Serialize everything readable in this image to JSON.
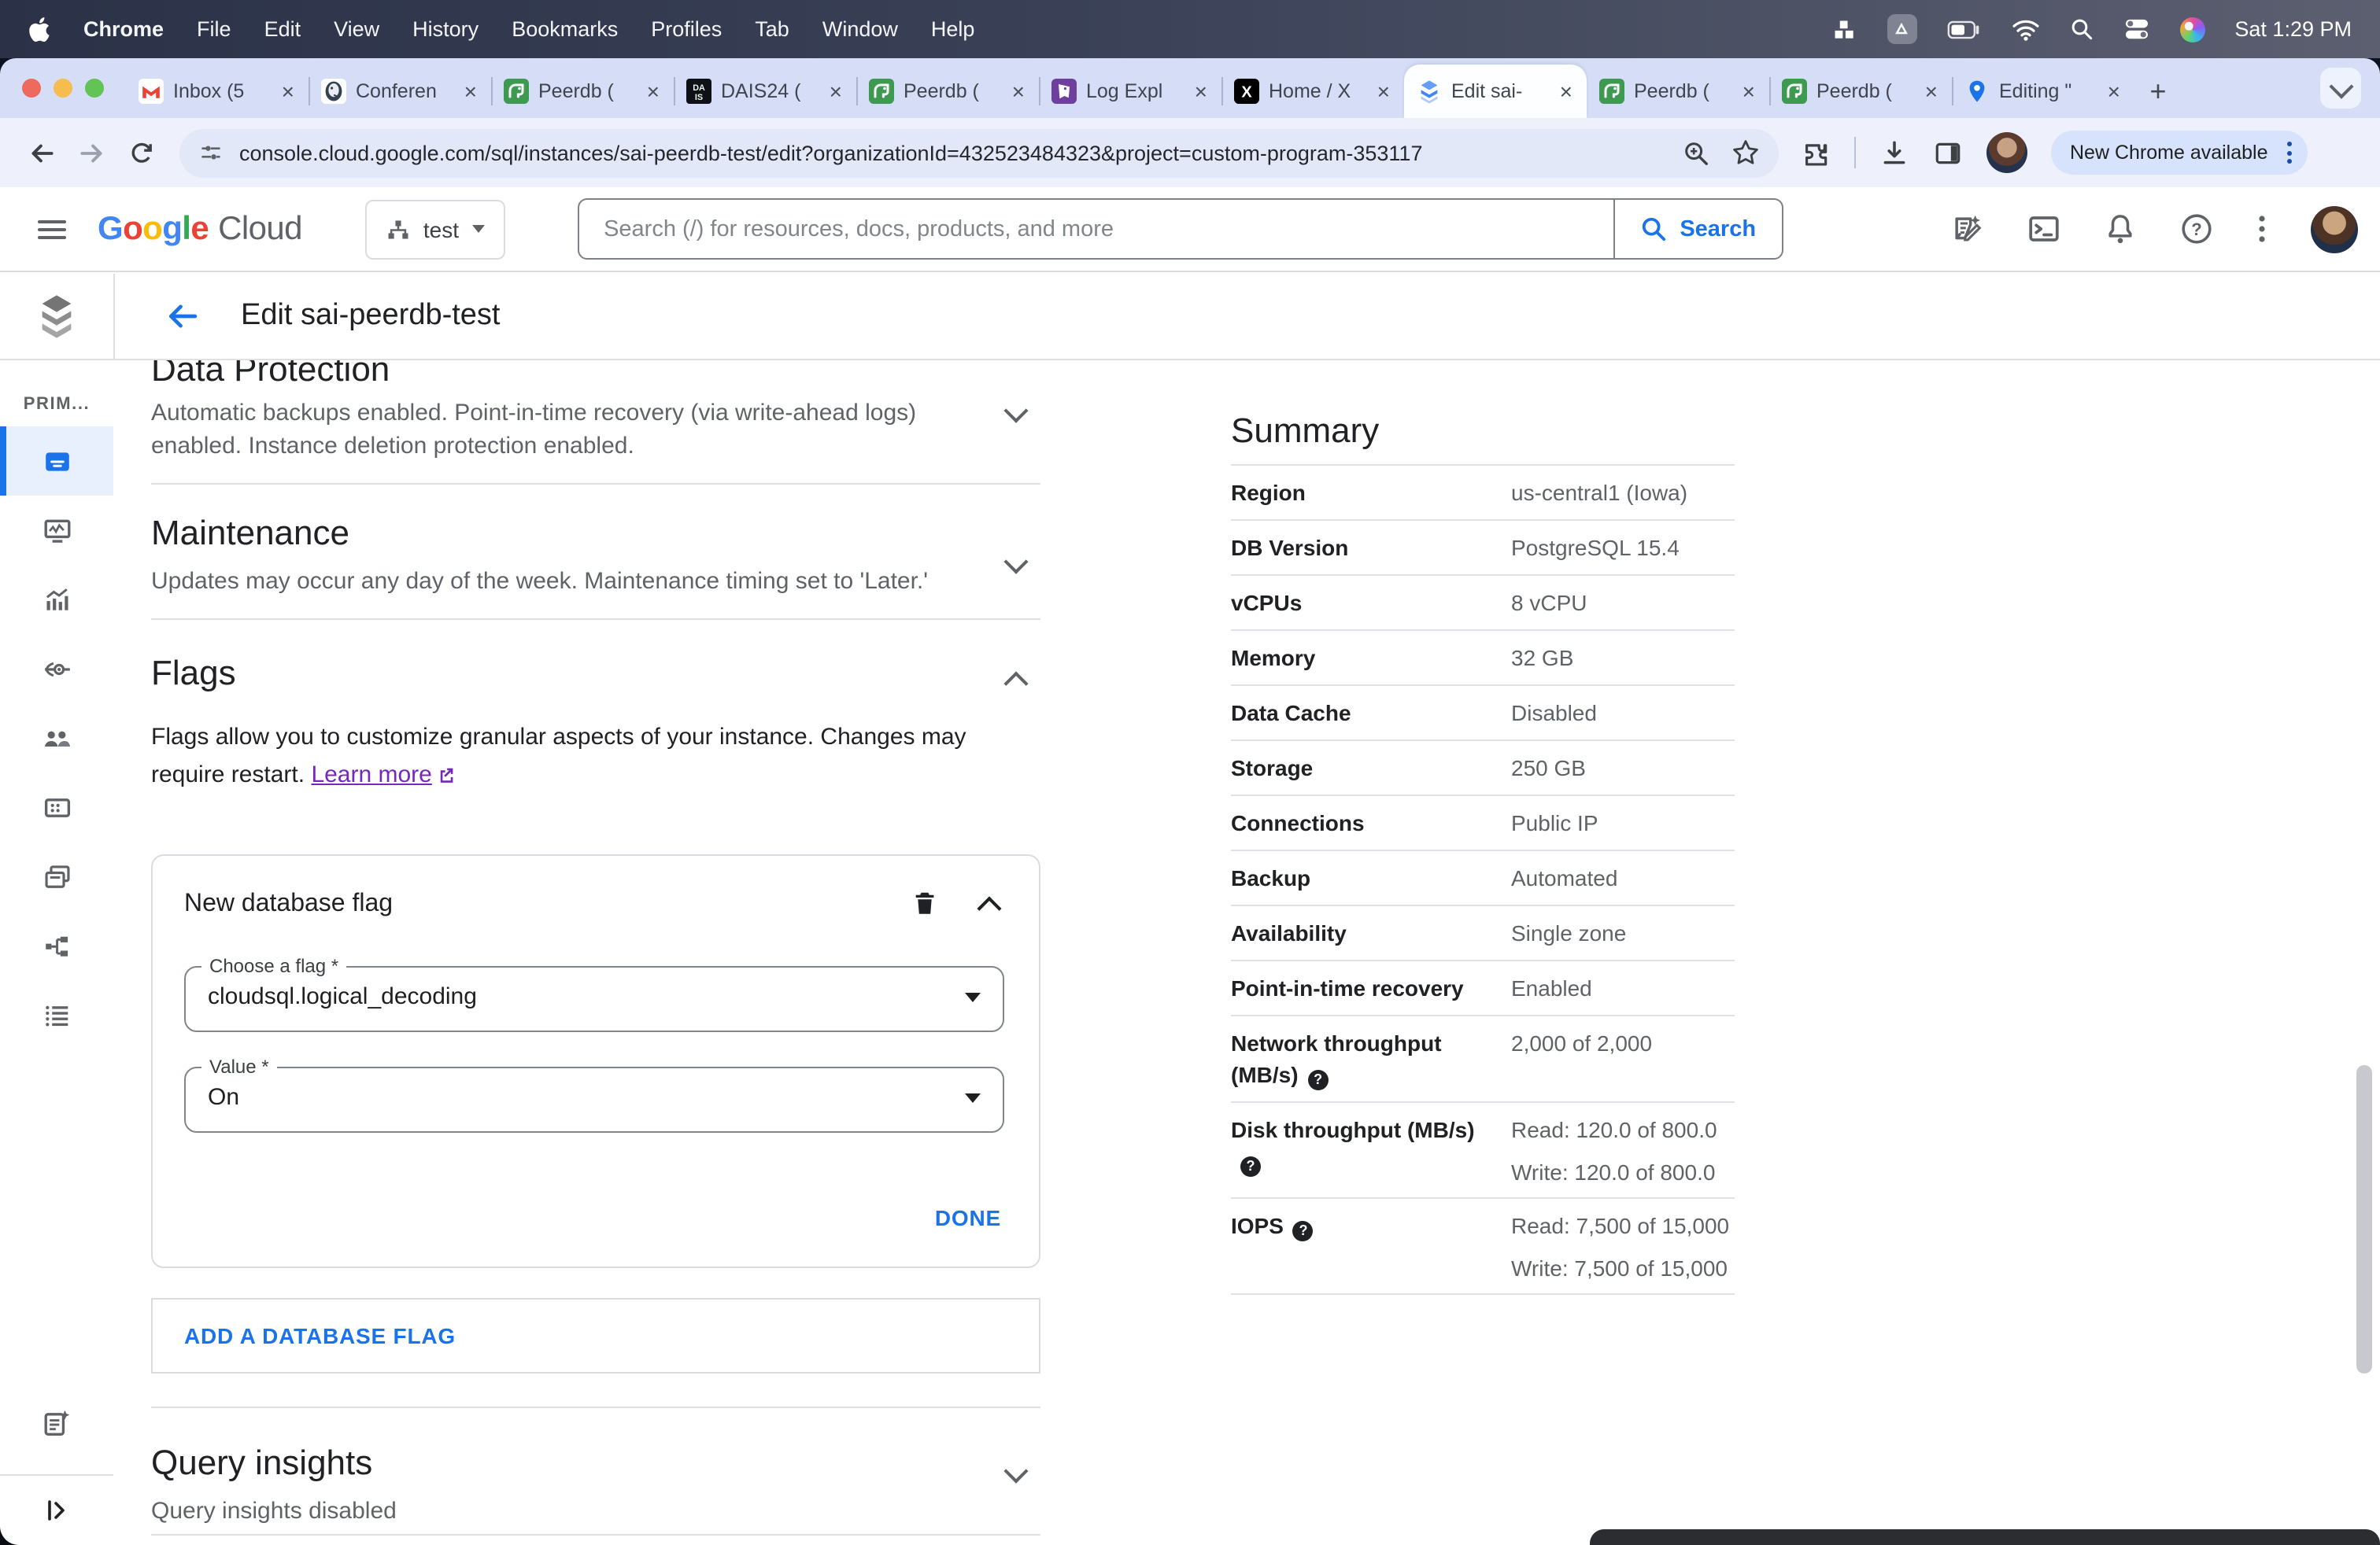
{
  "menubar": {
    "items": [
      "Chrome",
      "File",
      "Edit",
      "View",
      "History",
      "Bookmarks",
      "Profiles",
      "Tab",
      "Window",
      "Help"
    ],
    "clock": "Sat 1:29 PM"
  },
  "browser": {
    "tabs": [
      {
        "icon": "gmail",
        "label": "Inbox (5"
      },
      {
        "icon": "postgres",
        "label": "Conferen"
      },
      {
        "icon": "peerdb",
        "label": "Peerdb ("
      },
      {
        "icon": "dais",
        "label": "DAIS24 ("
      },
      {
        "icon": "peerdb",
        "label": "Peerdb ("
      },
      {
        "icon": "datadog",
        "label": "Log Expl"
      },
      {
        "icon": "x",
        "label": "Home / X"
      },
      {
        "icon": "cloudsql",
        "label": "Edit sai-",
        "active": true
      },
      {
        "icon": "peerdb",
        "label": "Peerdb ("
      },
      {
        "icon": "peerdb",
        "label": "Peerdb ("
      },
      {
        "icon": "maps",
        "label": "Editing \""
      }
    ],
    "url": "console.cloud.google.com/sql/instances/sai-peerdb-test/edit?organizationId=432523484323&project=custom-program-353117",
    "update_chip": "New Chrome available"
  },
  "cloud_header": {
    "logo_primary": "Google",
    "logo_secondary": "Cloud",
    "project": "test",
    "search_placeholder": "Search (/) for resources, docs, products, and more",
    "search_button": "Search"
  },
  "page_header": {
    "title": "Edit sai-peerdb-test"
  },
  "sidebar": {
    "section_label": "PRIM...",
    "items": [
      {
        "icon": "overview",
        "selected": true
      },
      {
        "icon": "system-insights"
      },
      {
        "icon": "query-insights"
      },
      {
        "icon": "connections"
      },
      {
        "icon": "users"
      },
      {
        "icon": "databases"
      },
      {
        "icon": "backups"
      },
      {
        "icon": "replicas"
      },
      {
        "icon": "operations"
      }
    ]
  },
  "sections": {
    "data_protection": {
      "title": "Data Protection",
      "description": "Automatic backups enabled. Point-in-time recovery (via write-ahead logs) enabled. Instance deletion protection enabled."
    },
    "maintenance": {
      "title": "Maintenance",
      "description": "Updates may occur any day of the week. Maintenance timing set to 'Later.'"
    },
    "flags": {
      "title": "Flags",
      "description": "Flags allow you to customize granular aspects of your instance. Changes may require restart.",
      "learn_more": "Learn more"
    },
    "flag_card": {
      "title": "New database flag",
      "flag_label": "Choose a flag *",
      "flag_value": "cloudsql.logical_decoding",
      "value_label": "Value *",
      "value_value": "On",
      "done": "DONE"
    },
    "add_flag_label": "ADD A DATABASE FLAG",
    "query_insights": {
      "title": "Query insights",
      "status": "Query insights disabled"
    }
  },
  "summary": {
    "title": "Summary",
    "rows": [
      {
        "label": "Region",
        "values": [
          "us-central1 (Iowa)"
        ]
      },
      {
        "label": "DB Version",
        "values": [
          "PostgreSQL 15.4"
        ]
      },
      {
        "label": "vCPUs",
        "values": [
          "8 vCPU"
        ]
      },
      {
        "label": "Memory",
        "values": [
          "32 GB"
        ]
      },
      {
        "label": "Data Cache",
        "values": [
          "Disabled"
        ]
      },
      {
        "label": "Storage",
        "values": [
          "250 GB"
        ]
      },
      {
        "label": "Connections",
        "values": [
          "Public IP"
        ]
      },
      {
        "label": "Backup",
        "values": [
          "Automated"
        ]
      },
      {
        "label": "Availability",
        "values": [
          "Single zone"
        ]
      },
      {
        "label": "Point-in-time recovery",
        "values": [
          "Enabled"
        ]
      },
      {
        "label": "Network throughput (MB/s)",
        "help": true,
        "values": [
          "2,000 of 2,000"
        ]
      },
      {
        "label": "Disk throughput (MB/s)",
        "help": true,
        "values": [
          "Read: 120.0 of 800.0",
          "Write: 120.0 of 800.0"
        ]
      },
      {
        "label": "IOPS",
        "help": true,
        "values": [
          "Read: 7,500 of 15,000",
          "Write: 7,500 of 15,000"
        ]
      }
    ]
  },
  "colors": {
    "accent": "#1a73e8",
    "link_visited": "#7627bc",
    "selected_nav_bg": "#e8f0fe",
    "google_letters": [
      "#4285F4",
      "#EA4335",
      "#FBBC05",
      "#4285F4",
      "#34A853",
      "#EA4335"
    ],
    "traffic_lights": [
      "#ee6a5f",
      "#f5bd4f",
      "#61c455"
    ]
  }
}
